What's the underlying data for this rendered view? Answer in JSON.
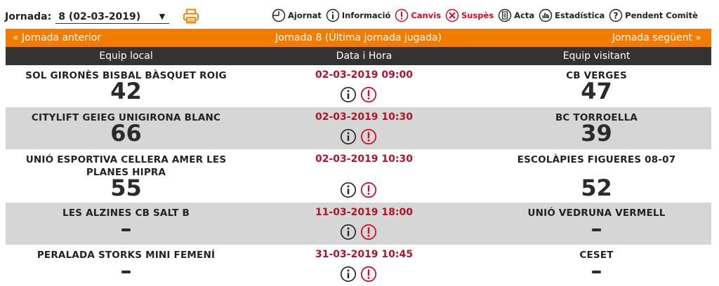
{
  "jornada": {
    "label": "Jornada:",
    "selected": "8 (02-03-2019)"
  },
  "legend": [
    {
      "icon": "clock-icon",
      "label": "Ajornat",
      "red": false
    },
    {
      "icon": "info-icon",
      "label": "Informació",
      "red": false
    },
    {
      "icon": "exclamation-icon",
      "label": "Canvis",
      "red": true
    },
    {
      "icon": "x-circle-icon",
      "label": "Suspès",
      "red": true
    },
    {
      "icon": "document-icon",
      "label": "Acta",
      "red": false
    },
    {
      "icon": "stats-icon",
      "label": "Estadística",
      "red": false
    },
    {
      "icon": "question-icon",
      "label": "Pendent Comitè",
      "red": false
    }
  ],
  "nav": {
    "prev": "«  Jornada anterior",
    "current": "Jornada 8 (Última jornada jugada)",
    "next": "Jornada següent  »"
  },
  "headers": {
    "local": "Equip local",
    "date": "Data i Hora",
    "away": "Equip visitant"
  },
  "games": [
    {
      "local": "SOL GIRONÈS BISBAL BÀSQUET ROIG",
      "local_score": "42",
      "datetime": "02-03-2019 09:00",
      "away": "CB VERGES",
      "away_score": "47"
    },
    {
      "local": "CITYLIFT GEIEG UNIGIRONA BLANC",
      "local_score": "66",
      "datetime": "02-03-2019 10:30",
      "away": "BC TORROELLA",
      "away_score": "39"
    },
    {
      "local": "UNIÓ ESPORTIVA CELLERA AMER LES PLANES HIPRA",
      "local_score": "55",
      "datetime": "02-03-2019 10:30",
      "away": "ESCOLÀPIES FIGUERES 08-07",
      "away_score": "52"
    },
    {
      "local": "LES ALZINES CB SALT B",
      "local_score": "–",
      "datetime": "11-03-2019 18:00",
      "away": "UNIÓ VEDRUNA VERMELL",
      "away_score": "–"
    },
    {
      "local": "PERALADA STORKS MINI FEMENÍ",
      "local_score": "–",
      "datetime": "31-03-2019 10:45",
      "away": "CESET",
      "away_score": "–"
    }
  ],
  "colors": {
    "orange": "#f07c00",
    "dark": "#333333",
    "red": "#c8102e",
    "shade": "#d6d6d6"
  }
}
